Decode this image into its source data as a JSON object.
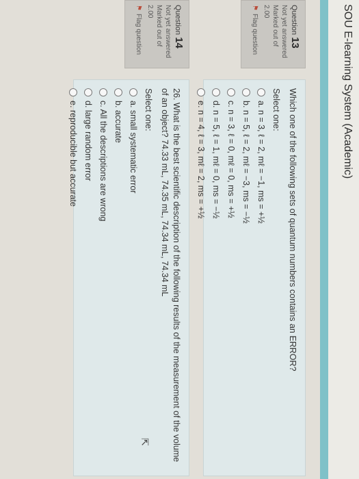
{
  "site": {
    "title": "SOU E-learning System (Academic)"
  },
  "questions": [
    {
      "label": "Question",
      "number": "13",
      "status": "Not yet answered",
      "marked_label": "Marked out of",
      "marked_value": "2.00",
      "flag_label": "Flag question",
      "text": "Which one of the following sets of quantum numbers contains an ERROR?",
      "select_label": "Select one:",
      "options": [
        "a. n = 3, ℓ = 2, mℓ = −1, ms = +½",
        "b. n = 5, ℓ = 2, mℓ = −3, ms = −½",
        "c. n = 3, ℓ = 0, mℓ = 0, ms = +½",
        "d. n = 5, ℓ = 1, mℓ = 0, ms = −½",
        "e. n = 4, ℓ = 3, mℓ = 2, ms = +½"
      ]
    },
    {
      "label": "Question",
      "number": "14",
      "status": "Not yet answered",
      "marked_label": "Marked out of",
      "marked_value": "2.00",
      "flag_label": "Flag question",
      "text": "26. What is the best scientific description of the following results of the measurement of the volume of an object? 74.33 mL, 74.35 mL, 74.34 mL, 74.34 mL",
      "select_label": "Select one:",
      "options": [
        "a. small systematic error",
        "b. accurate",
        "c. All the descriptions are wrong",
        "d. large random error",
        "e. reproducible but accurate"
      ]
    }
  ],
  "icons": {
    "flag": "flag-icon",
    "radio": "radio-icon",
    "pointer": "mouse-pointer-icon"
  }
}
